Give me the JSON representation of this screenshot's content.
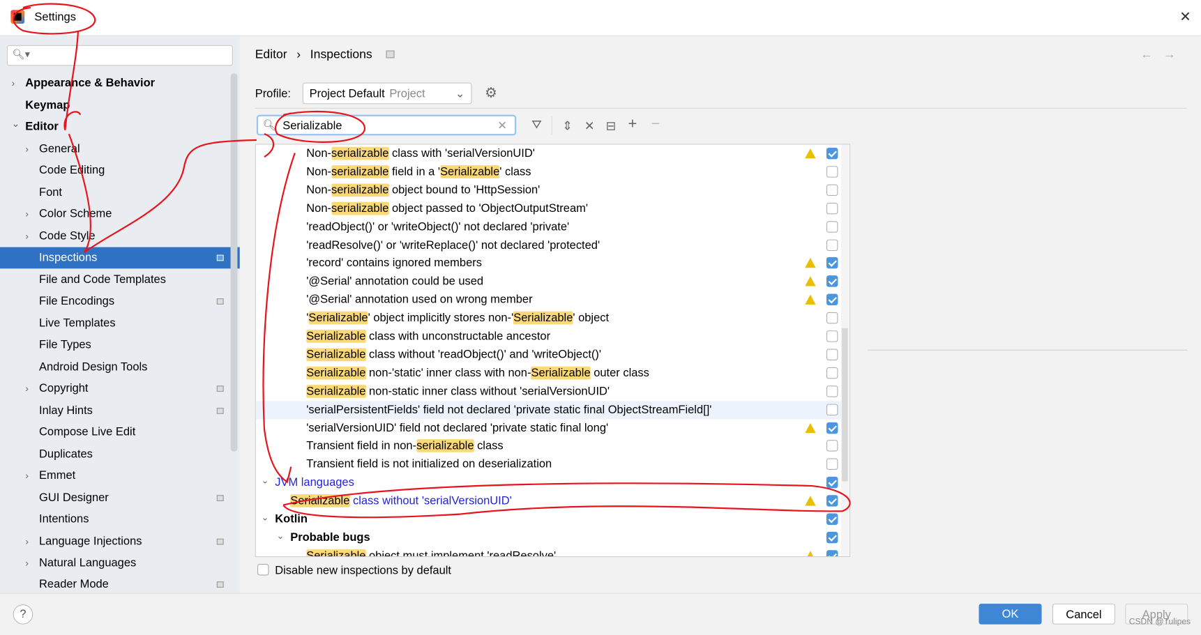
{
  "window": {
    "title": "Settings",
    "close_icon": "close-icon"
  },
  "sidebar": {
    "search_placeholder": "",
    "items": [
      {
        "label": "Appearance & Behavior",
        "level": 0,
        "expand": "collapsed",
        "bold": true
      },
      {
        "label": "Keymap",
        "level": 0,
        "bold": true
      },
      {
        "label": "Editor",
        "level": 0,
        "expand": "expanded",
        "bold": true
      },
      {
        "label": "General",
        "level": 1,
        "expand": "collapsed"
      },
      {
        "label": "Code Editing",
        "level": 1
      },
      {
        "label": "Font",
        "level": 1
      },
      {
        "label": "Color Scheme",
        "level": 1,
        "expand": "collapsed"
      },
      {
        "label": "Code Style",
        "level": 1,
        "expand": "collapsed"
      },
      {
        "label": "Inspections",
        "level": 1,
        "selected": true,
        "badge": true
      },
      {
        "label": "File and Code Templates",
        "level": 1
      },
      {
        "label": "File Encodings",
        "level": 1,
        "badge": true
      },
      {
        "label": "Live Templates",
        "level": 1
      },
      {
        "label": "File Types",
        "level": 1
      },
      {
        "label": "Android Design Tools",
        "level": 1
      },
      {
        "label": "Copyright",
        "level": 1,
        "expand": "collapsed",
        "badge": true
      },
      {
        "label": "Inlay Hints",
        "level": 1,
        "badge": true
      },
      {
        "label": "Compose Live Edit",
        "level": 1
      },
      {
        "label": "Duplicates",
        "level": 1
      },
      {
        "label": "Emmet",
        "level": 1,
        "expand": "collapsed"
      },
      {
        "label": "GUI Designer",
        "level": 1,
        "badge": true
      },
      {
        "label": "Intentions",
        "level": 1
      },
      {
        "label": "Language Injections",
        "level": 1,
        "expand": "collapsed",
        "badge": true
      },
      {
        "label": "Natural Languages",
        "level": 1,
        "expand": "collapsed"
      },
      {
        "label": "Reader Mode",
        "level": 1,
        "badge": true
      }
    ]
  },
  "header": {
    "breadcrumb": [
      "Editor",
      "Inspections"
    ],
    "sep": "›",
    "back_icon": "arrow-left-icon",
    "forward_icon": "arrow-right-icon"
  },
  "profile": {
    "label": "Profile:",
    "value": "Project Default",
    "scope": "Project"
  },
  "search": {
    "value": "Serializable"
  },
  "toolbar": [
    "filter-icon",
    "expand-all-icon",
    "collapse-all-icon",
    "reset-icon",
    "add-icon",
    "remove-icon"
  ],
  "tree": [
    {
      "level": 2,
      "parts": [
        {
          "t": "Non-"
        },
        {
          "t": "serializable",
          "hl": true
        },
        {
          "t": " class with 'serialVersionUID'"
        }
      ],
      "warn": true,
      "checked": true
    },
    {
      "level": 2,
      "parts": [
        {
          "t": "Non-"
        },
        {
          "t": "serializable",
          "hl": true
        },
        {
          "t": " field in a '"
        },
        {
          "t": "Serializable",
          "hl": true
        },
        {
          "t": "' class"
        }
      ],
      "checked": false
    },
    {
      "level": 2,
      "parts": [
        {
          "t": "Non-"
        },
        {
          "t": "serializable",
          "hl": true
        },
        {
          "t": " object bound to 'HttpSession'"
        }
      ],
      "checked": false
    },
    {
      "level": 2,
      "parts": [
        {
          "t": "Non-"
        },
        {
          "t": "serializable",
          "hl": true
        },
        {
          "t": " object passed to 'ObjectOutputStream'"
        }
      ],
      "checked": false
    },
    {
      "level": 2,
      "parts": [
        {
          "t": "'readObject()' or 'writeObject()' not declared 'private'"
        }
      ],
      "checked": false
    },
    {
      "level": 2,
      "parts": [
        {
          "t": "'readResolve()' or 'writeReplace()' not declared 'protected'"
        }
      ],
      "checked": false
    },
    {
      "level": 2,
      "parts": [
        {
          "t": "'record' contains ignored members"
        }
      ],
      "warn": true,
      "checked": true
    },
    {
      "level": 2,
      "parts": [
        {
          "t": "'@Serial' annotation could be used"
        }
      ],
      "warn": true,
      "checked": true
    },
    {
      "level": 2,
      "parts": [
        {
          "t": "'@Serial' annotation used on wrong member"
        }
      ],
      "warn": true,
      "checked": true
    },
    {
      "level": 2,
      "parts": [
        {
          "t": "'"
        },
        {
          "t": "Serializable",
          "hl": true
        },
        {
          "t": "' object implicitly stores non-'"
        },
        {
          "t": "Serializable",
          "hl": true
        },
        {
          "t": "' object"
        }
      ],
      "checked": false
    },
    {
      "level": 2,
      "parts": [
        {
          "t": "Serializable",
          "hl": true
        },
        {
          "t": " class with unconstructable ancestor"
        }
      ],
      "checked": false
    },
    {
      "level": 2,
      "parts": [
        {
          "t": "Serializable",
          "hl": true
        },
        {
          "t": " class without 'readObject()' and 'writeObject()'"
        }
      ],
      "checked": false
    },
    {
      "level": 2,
      "parts": [
        {
          "t": "Serializable",
          "hl": true
        },
        {
          "t": " non-'static' inner class with non-"
        },
        {
          "t": "Serializable",
          "hl": true
        },
        {
          "t": " outer class"
        }
      ],
      "checked": false
    },
    {
      "level": 2,
      "parts": [
        {
          "t": "Serializable",
          "hl": true
        },
        {
          "t": " non-static inner class without 'serialVersionUID'"
        }
      ],
      "checked": false
    },
    {
      "level": 2,
      "parts": [
        {
          "t": "'serialPersistentFields' field not declared 'private static final ObjectStreamField[]'"
        }
      ],
      "checked": false,
      "hover": true
    },
    {
      "level": 2,
      "parts": [
        {
          "t": "'serialVersionUID' field not declared 'private static final long'"
        }
      ],
      "warn": true,
      "checked": true
    },
    {
      "level": 2,
      "parts": [
        {
          "t": "Transient field in non-"
        },
        {
          "t": "serializable",
          "hl": true
        },
        {
          "t": " class"
        }
      ],
      "checked": false
    },
    {
      "level": 2,
      "parts": [
        {
          "t": "Transient field is not initialized on deserialization"
        }
      ],
      "checked": false
    },
    {
      "level": 0,
      "group": true,
      "expand": "expanded",
      "blue": true,
      "parts": [
        {
          "t": "JVM languages"
        }
      ],
      "checked": true
    },
    {
      "level": 1,
      "blue": true,
      "parts": [
        {
          "t": "Serializable",
          "hl": true
        },
        {
          "t": " class without 'serialVersionUID'"
        }
      ],
      "warn": true,
      "checked": true
    },
    {
      "level": 0,
      "group": true,
      "expand": "expanded",
      "bold": true,
      "parts": [
        {
          "t": "Kotlin"
        }
      ],
      "checked": true
    },
    {
      "level": 1,
      "group": true,
      "expand": "expanded",
      "bold": true,
      "parts": [
        {
          "t": "Probable bugs"
        }
      ],
      "checked": true
    },
    {
      "level": 2,
      "parts": [
        {
          "t": "Serializable",
          "hl": true
        },
        {
          "t": " object must implement 'readResolve'"
        }
      ],
      "warn": true,
      "checked": true
    }
  ],
  "options": {
    "disable_new_label": "Disable new inspections by default",
    "disable_new_checked": false
  },
  "footer": {
    "help": "?",
    "ok": "OK",
    "cancel": "Cancel",
    "apply": "Apply"
  },
  "watermark": "CSDN @Tulipes",
  "colors": {
    "accent": "#2f72c4",
    "highlight": "#fbd977",
    "warning": "#e8c000",
    "checkbox": "#4a97e0",
    "annotation": "#e8141c"
  }
}
